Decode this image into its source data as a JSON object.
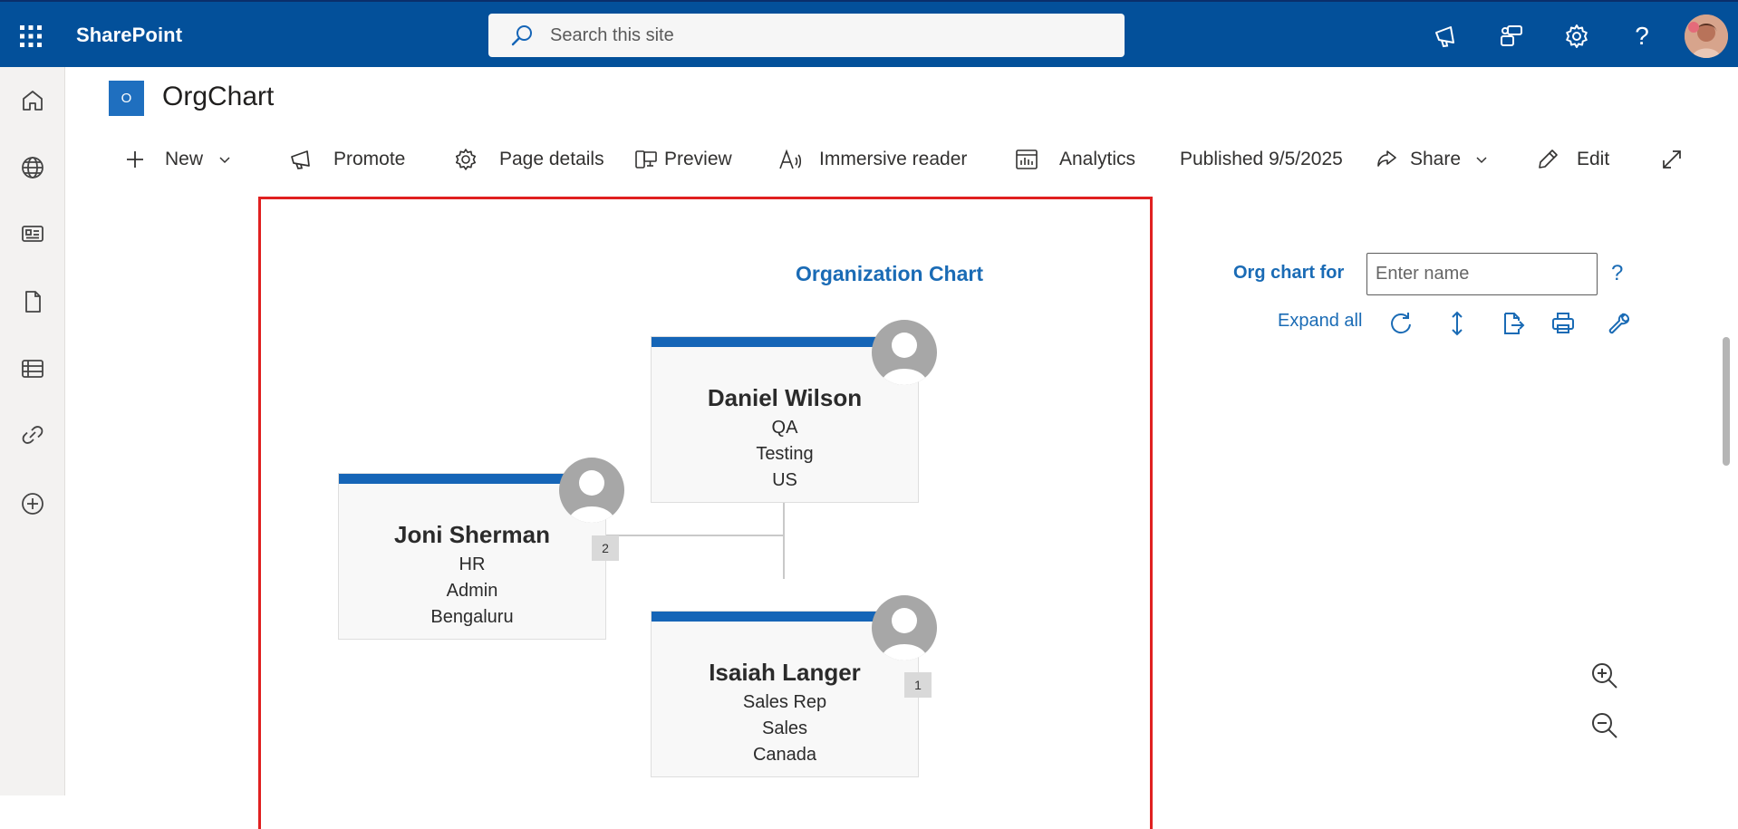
{
  "suitebar": {
    "brand": "SharePoint",
    "search_placeholder": "Search this site"
  },
  "site": {
    "logo_letter": "O",
    "title": "OrgChart"
  },
  "commands": {
    "new": "New",
    "promote": "Promote",
    "page_details": "Page details",
    "preview": "Preview",
    "immersive_reader": "Immersive reader",
    "analytics": "Analytics",
    "published": "Published 9/5/2025",
    "share": "Share",
    "edit": "Edit"
  },
  "orgchart": {
    "title": "Organization Chart",
    "people": [
      {
        "name": "Daniel Wilson",
        "title": "QA",
        "department": "Testing",
        "location": "US"
      },
      {
        "name": "Joni Sherman",
        "title": "HR",
        "department": "Admin",
        "location": "Bengaluru",
        "reports": "2"
      },
      {
        "name": "Isaiah Langer",
        "title": "Sales Rep",
        "department": "Sales",
        "location": "Canada",
        "reports": "1"
      }
    ]
  },
  "panel": {
    "org_chart_for_label": "Org chart for",
    "name_placeholder": "Enter name",
    "help": "?",
    "expand_all": "Expand all"
  },
  "colors": {
    "suitebar": "#03509a",
    "accent": "#1565b7",
    "link": "#1a6bb5",
    "frame_highlight": "#e02020"
  }
}
